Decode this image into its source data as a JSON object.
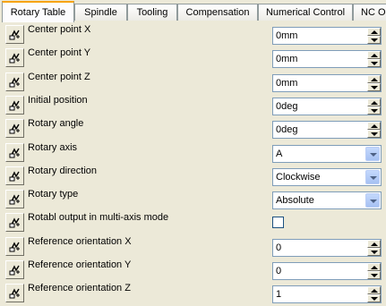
{
  "tabs": [
    {
      "label": "Rotary Table",
      "active": true
    },
    {
      "label": "Spindle"
    },
    {
      "label": "Tooling"
    },
    {
      "label": "Compensation"
    },
    {
      "label": "Numerical Control"
    },
    {
      "label": "NC Ou"
    }
  ],
  "rows": [
    {
      "label": "Center point X",
      "kind": "spin",
      "value": "0mm"
    },
    {
      "label": "Center point Y",
      "kind": "spin",
      "value": "0mm"
    },
    {
      "label": "Center point Z",
      "kind": "spin",
      "value": "0mm"
    },
    {
      "label": "Initial position",
      "kind": "spin",
      "value": "0deg"
    },
    {
      "label": "Rotary angle",
      "kind": "spin",
      "value": "0deg"
    },
    {
      "label": "Rotary axis",
      "kind": "combo",
      "value": "A"
    },
    {
      "label": "Rotary direction",
      "kind": "combo",
      "value": "Clockwise"
    },
    {
      "label": "Rotary type",
      "kind": "combo",
      "value": "Absolute"
    },
    {
      "label": "Rotabl output in multi-axis mode",
      "kind": "check",
      "checked": false
    },
    {
      "label": "Reference orientation X",
      "kind": "spin",
      "value": "0"
    },
    {
      "label": "Reference orientation Y",
      "kind": "spin",
      "value": "0"
    },
    {
      "label": "Reference orientation Z",
      "kind": "spin",
      "value": "1"
    }
  ],
  "icons": {
    "row_button": "formula-icon"
  },
  "colors": {
    "active_tab_accent": "#f7a30b",
    "panel_bg": "#ece9d8",
    "field_border": "#7f9db9"
  }
}
